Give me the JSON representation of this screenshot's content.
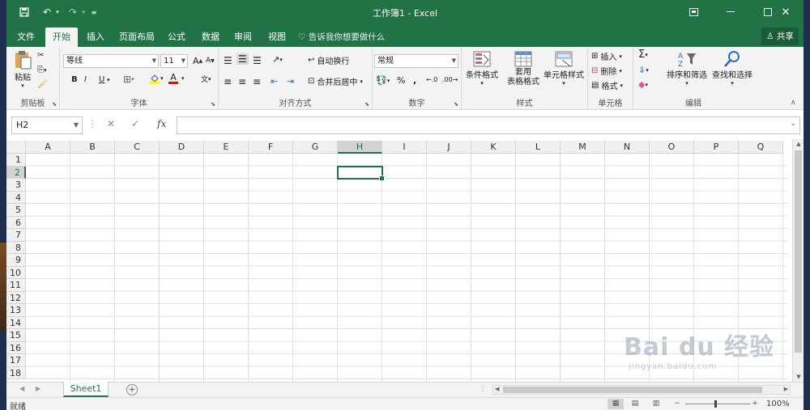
{
  "window": {
    "title": "工作簿1 - Excel"
  },
  "ribbon_tabs": [
    "文件",
    "开始",
    "插入",
    "页面布局",
    "公式",
    "数据",
    "审阅",
    "视图"
  ],
  "active_tab": "开始",
  "tell_me": "告诉我你想要做什么",
  "share_label": "共享",
  "clipboard": {
    "paste": "粘贴",
    "group": "剪贴板"
  },
  "font": {
    "name": "等线",
    "size": "11",
    "group": "字体",
    "bold": "B",
    "italic": "I",
    "underline": "U",
    "grow": "A",
    "shrink": "A",
    "font_color": "A",
    "phonetic": "文"
  },
  "alignment": {
    "wrap": "自动换行",
    "merge": "合并后居中",
    "group": "对齐方式"
  },
  "number": {
    "format": "常规",
    "percent": "%",
    "comma": ",",
    "group": "数字"
  },
  "styles": {
    "conditional": "条件格式",
    "table_line1": "套用",
    "table_line2": "表格格式",
    "cell_styles": "单元格样式",
    "group": "样式"
  },
  "cells_group": {
    "insert": "插入",
    "delete": "删除",
    "format": "格式",
    "group": "单元格"
  },
  "editing": {
    "sort": "排序和筛选",
    "find": "查找和选择",
    "group": "编辑"
  },
  "formula_bar": {
    "name_box": "H2",
    "fx": "fx",
    "value": ""
  },
  "grid": {
    "columns": [
      "A",
      "B",
      "C",
      "D",
      "E",
      "F",
      "G",
      "H",
      "I",
      "J",
      "K",
      "L",
      "M",
      "N",
      "O",
      "P",
      "Q"
    ],
    "rows": [
      "1",
      "2",
      "3",
      "4",
      "5",
      "6",
      "7",
      "8",
      "9",
      "10",
      "11",
      "12",
      "13",
      "14",
      "15",
      "16",
      "17",
      "18"
    ],
    "selected_column": "H",
    "selected_row": "2"
  },
  "sheets": [
    "Sheet1"
  ],
  "status": {
    "text": "就绪",
    "zoom": "100%"
  },
  "watermark": {
    "main": "Bai du 经验",
    "sub": "jingyan.baidu.com"
  },
  "colors": {
    "accent": "#217346",
    "ribbon": "#f3f3f3"
  }
}
